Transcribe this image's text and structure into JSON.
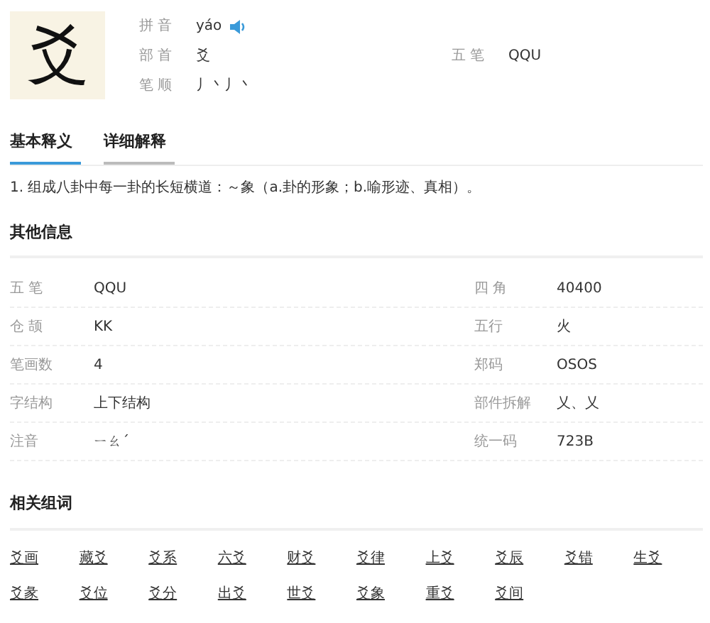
{
  "character": "爻",
  "header_fields": [
    {
      "label": "拼 音",
      "value": "yáo",
      "kind": "audio"
    },
    {
      "label": "部 首",
      "value": "爻",
      "kind": "plain",
      "extra_label": "五 笔",
      "extra_value": "QQU"
    },
    {
      "label": "笔 顺",
      "value": "丿丶丿丶",
      "kind": "plain"
    }
  ],
  "tabs": [
    {
      "label": "基本释义",
      "selected": true
    },
    {
      "label": "详细解释",
      "selected": false
    }
  ],
  "definition": "1. 组成八卦中每一卦的长短横道：～象（a.卦的形象；b.喻形迹、真相）。",
  "other_info": {
    "title": "其他信息",
    "rows": [
      {
        "label": "五 笔",
        "value": "QQU",
        "label_2": "四 角",
        "value_2": "40400"
      },
      {
        "label": "仓 颉",
        "value": "KK",
        "label_2": "五行",
        "value_2": "火"
      },
      {
        "label": "笔画数",
        "value": "4",
        "label_2": "郑码",
        "value_2": "OSOS"
      },
      {
        "label": "字结构",
        "value": "上下结构",
        "label_2": "部件拆解",
        "value_2": "乂、乂"
      },
      {
        "label": "注音",
        "value": "ㄧㄠˊ",
        "label_2": "统一码",
        "value_2": "723B"
      }
    ]
  },
  "related_words": {
    "title": "相关组词",
    "words": [
      "爻画",
      "藏爻",
      "爻系",
      "六爻",
      "财爻",
      "爻律",
      "上爻",
      "爻辰",
      "爻错",
      "生爻",
      "爻彖",
      "爻位",
      "爻分",
      "出爻",
      "世爻",
      "爻象",
      "重爻",
      "爻间"
    ]
  }
}
